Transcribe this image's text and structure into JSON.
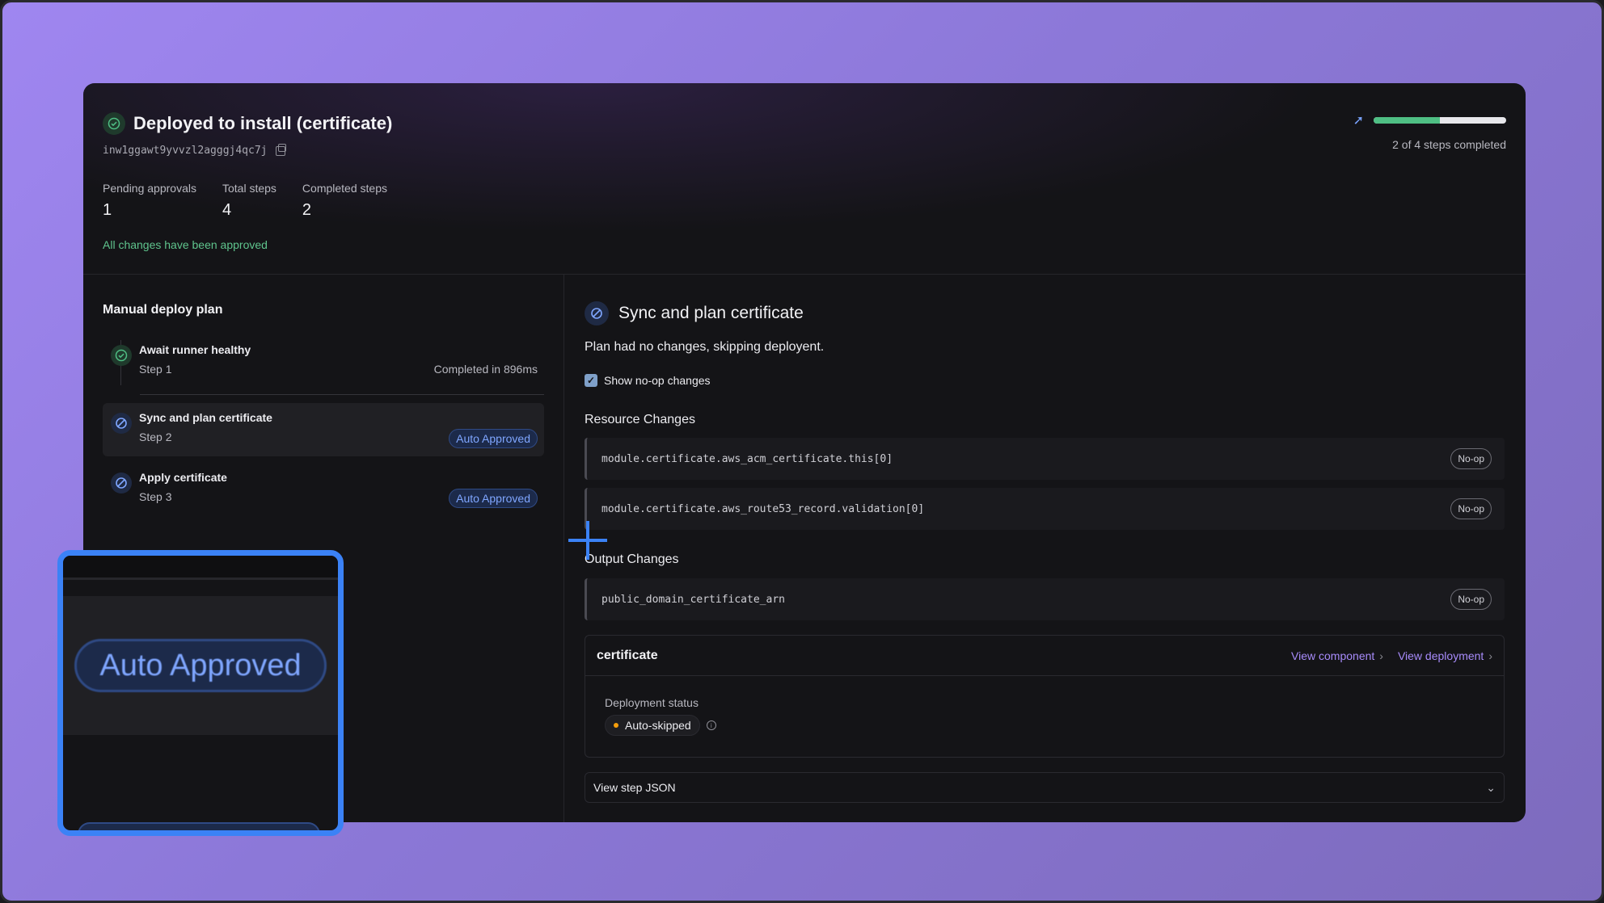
{
  "header": {
    "title": "Deployed to install (certificate)",
    "install_id": "inw1ggawt9yvvzl2agggj4qc7j",
    "stats": [
      {
        "label": "Pending approvals",
        "value": "1"
      },
      {
        "label": "Total steps",
        "value": "4"
      },
      {
        "label": "Completed steps",
        "value": "2"
      }
    ],
    "approved_message": "All changes have been approved",
    "progress_text": "2 of 4 steps completed",
    "progress_fraction": 0.5
  },
  "plan": {
    "title": "Manual deploy plan",
    "steps": [
      {
        "name": "Await runner healthy",
        "number": "Step 1",
        "meta": "Completed in 896ms",
        "status": "ok"
      },
      {
        "name": "Sync and plan certificate",
        "number": "Step 2",
        "badge": "Auto Approved",
        "status": "skip"
      },
      {
        "name": "Apply certificate",
        "number": "Step 3",
        "badge": "Auto Approved",
        "status": "skip"
      }
    ]
  },
  "zoom": {
    "badge": "Auto Approved"
  },
  "detail": {
    "title": "Sync and plan certificate",
    "message": "Plan had no changes, skipping deployent.",
    "show_noop_label": "Show no-op changes",
    "show_noop_checked": true,
    "resource_heading": "Resource Changes",
    "resources": [
      {
        "name": "module.certificate.aws_acm_certificate.this[0]",
        "badge": "No-op"
      },
      {
        "name": "module.certificate.aws_route53_record.validation[0]",
        "badge": "No-op"
      }
    ],
    "output_heading": "Output Changes",
    "outputs": [
      {
        "name": "public_domain_certificate_arn",
        "badge": "No-op"
      }
    ],
    "component": {
      "name": "certificate",
      "view_component": "View component",
      "view_deployment": "View deployment",
      "status_label": "Deployment status",
      "status_value": "Auto-skipped"
    },
    "json_toggle": "View step JSON"
  },
  "colors": {
    "success": "#4fbf84",
    "accent": "#7fa6ff",
    "link": "#a78bfa",
    "warning": "#f59e0b",
    "highlight": "#3b82f6"
  }
}
